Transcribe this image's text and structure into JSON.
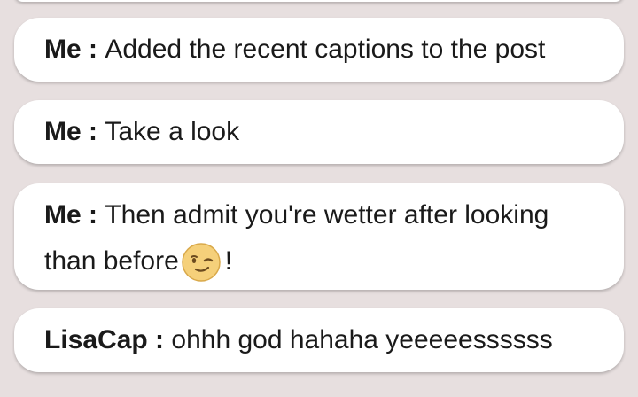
{
  "messages": [
    {
      "sender": "Me",
      "separator": " : ",
      "text": "Added the recent captions to the post"
    },
    {
      "sender": "Me",
      "separator": " : ",
      "text": "Take a look"
    },
    {
      "sender": "Me",
      "separator": " : ",
      "text": "Then admit you're wetter after looking than before",
      "after_emoji": "!",
      "emoji": "wink-emoji"
    },
    {
      "sender": "LisaCap",
      "separator": " : ",
      "text": "ohhh god hahaha yeeeeessssss"
    }
  ],
  "colors": {
    "background": "#e7dfdf",
    "bubble": "#ffffff",
    "text": "#1a1a1a",
    "emoji_face": "#f5d07a"
  }
}
